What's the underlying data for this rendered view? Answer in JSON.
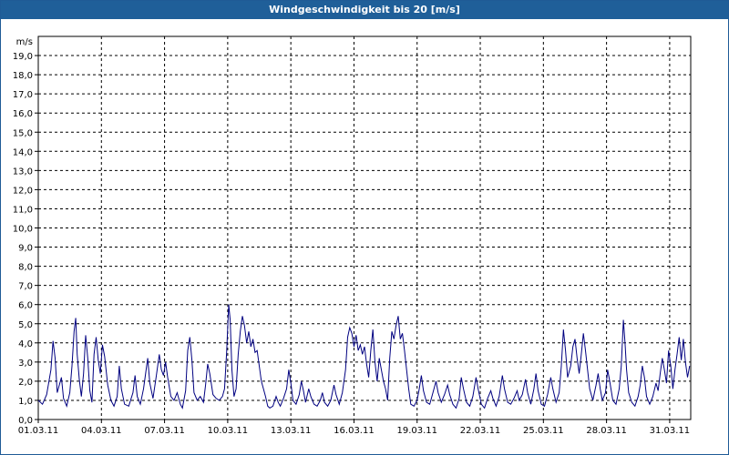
{
  "window": {
    "title": "Windgeschwindigkeit bis 20 [m/s]"
  },
  "chart_data": {
    "type": "line",
    "title": "Windgeschwindigkeit bis 20 [m/s]",
    "ylabel": "m/s",
    "ylim": [
      0,
      20
    ],
    "xlim": [
      0,
      31
    ],
    "y_ticks": [
      "0,0",
      "1,0",
      "2,0",
      "3,0",
      "4,0",
      "5,0",
      "6,0",
      "7,0",
      "8,0",
      "9,0",
      "10,0",
      "11,0",
      "12,0",
      "13,0",
      "14,0",
      "15,0",
      "16,0",
      "17,0",
      "18,0",
      "19,0"
    ],
    "x_ticks": [
      {
        "day": 0,
        "label": "01.03.11"
      },
      {
        "day": 3,
        "label": "04.03.11"
      },
      {
        "day": 6,
        "label": "07.03.11"
      },
      {
        "day": 9,
        "label": "10.03.11"
      },
      {
        "day": 12,
        "label": "13.03.11"
      },
      {
        "day": 15,
        "label": "16.03.11"
      },
      {
        "day": 18,
        "label": "19.03.11"
      },
      {
        "day": 21,
        "label": "22.03.11"
      },
      {
        "day": 24,
        "label": "25.03.11"
      },
      {
        "day": 27,
        "label": "28.03.11"
      },
      {
        "day": 30,
        "label": "31.03.11"
      }
    ],
    "grid": true,
    "line_color": "#000080",
    "series": [
      {
        "values": [
          [
            0.0,
            1.0
          ],
          [
            0.2,
            0.8
          ],
          [
            0.4,
            1.3
          ],
          [
            0.6,
            2.6
          ],
          [
            0.7,
            4.1
          ],
          [
            0.8,
            3.2
          ],
          [
            0.9,
            1.4
          ],
          [
            1.0,
            1.8
          ],
          [
            1.1,
            2.2
          ],
          [
            1.2,
            1.1
          ],
          [
            1.35,
            0.7
          ],
          [
            1.5,
            1.4
          ],
          [
            1.6,
            2.8
          ],
          [
            1.7,
            4.6
          ],
          [
            1.78,
            5.3
          ],
          [
            1.85,
            3.4
          ],
          [
            1.95,
            2.1
          ],
          [
            2.05,
            1.2
          ],
          [
            2.15,
            2.4
          ],
          [
            2.25,
            4.4
          ],
          [
            2.35,
            3.2
          ],
          [
            2.45,
            1.5
          ],
          [
            2.55,
            0.9
          ],
          [
            2.65,
            3.4
          ],
          [
            2.75,
            4.3
          ],
          [
            2.85,
            3.1
          ],
          [
            2.95,
            2.4
          ],
          [
            3.05,
            3.9
          ],
          [
            3.15,
            3.3
          ],
          [
            3.3,
            1.8
          ],
          [
            3.45,
            1.0
          ],
          [
            3.6,
            0.7
          ],
          [
            3.75,
            1.2
          ],
          [
            3.85,
            2.8
          ],
          [
            3.95,
            1.6
          ],
          [
            4.1,
            0.8
          ],
          [
            4.3,
            0.7
          ],
          [
            4.5,
            1.4
          ],
          [
            4.6,
            2.3
          ],
          [
            4.7,
            1.2
          ],
          [
            4.85,
            0.8
          ],
          [
            5.0,
            1.6
          ],
          [
            5.1,
            2.4
          ],
          [
            5.2,
            3.2
          ],
          [
            5.3,
            1.9
          ],
          [
            5.45,
            1.1
          ],
          [
            5.6,
            2.2
          ],
          [
            5.75,
            3.4
          ],
          [
            5.85,
            2.6
          ],
          [
            5.95,
            2.3
          ],
          [
            6.05,
            3.0
          ],
          [
            6.15,
            2.2
          ],
          [
            6.3,
            1.2
          ],
          [
            6.45,
            1.0
          ],
          [
            6.6,
            1.4
          ],
          [
            6.75,
            0.8
          ],
          [
            6.85,
            0.6
          ],
          [
            7.0,
            1.5
          ],
          [
            7.1,
            3.6
          ],
          [
            7.2,
            4.3
          ],
          [
            7.3,
            3.1
          ],
          [
            7.4,
            1.4
          ],
          [
            7.55,
            1.0
          ],
          [
            7.7,
            1.2
          ],
          [
            7.85,
            0.9
          ],
          [
            7.95,
            1.8
          ],
          [
            8.05,
            2.9
          ],
          [
            8.15,
            2.4
          ],
          [
            8.3,
            1.3
          ],
          [
            8.45,
            1.1
          ],
          [
            8.6,
            1.0
          ],
          [
            8.75,
            1.2
          ],
          [
            8.85,
            1.6
          ],
          [
            8.95,
            3.5
          ],
          [
            9.05,
            6.0
          ],
          [
            9.12,
            5.2
          ],
          [
            9.2,
            2.6
          ],
          [
            9.3,
            1.2
          ],
          [
            9.4,
            1.6
          ],
          [
            9.5,
            3.4
          ],
          [
            9.6,
            4.6
          ],
          [
            9.7,
            5.4
          ],
          [
            9.8,
            4.9
          ],
          [
            9.9,
            4.0
          ],
          [
            10.0,
            4.6
          ],
          [
            10.1,
            3.8
          ],
          [
            10.2,
            4.2
          ],
          [
            10.3,
            3.5
          ],
          [
            10.4,
            3.6
          ],
          [
            10.5,
            2.8
          ],
          [
            10.6,
            2.0
          ],
          [
            10.7,
            1.6
          ],
          [
            10.8,
            1.2
          ],
          [
            10.9,
            0.7
          ],
          [
            11.0,
            0.6
          ],
          [
            11.15,
            0.7
          ],
          [
            11.3,
            1.2
          ],
          [
            11.4,
            0.9
          ],
          [
            11.5,
            0.7
          ],
          [
            11.65,
            1.1
          ],
          [
            11.8,
            1.6
          ],
          [
            11.9,
            2.6
          ],
          [
            12.0,
            1.9
          ],
          [
            12.1,
            1.0
          ],
          [
            12.25,
            0.8
          ],
          [
            12.4,
            1.3
          ],
          [
            12.5,
            2.0
          ],
          [
            12.6,
            1.5
          ],
          [
            12.7,
            0.9
          ],
          [
            12.85,
            1.6
          ],
          [
            12.95,
            1.2
          ],
          [
            13.1,
            0.8
          ],
          [
            13.25,
            0.7
          ],
          [
            13.4,
            1.0
          ],
          [
            13.5,
            1.4
          ],
          [
            13.6,
            0.9
          ],
          [
            13.75,
            0.7
          ],
          [
            13.9,
            1.0
          ],
          [
            14.05,
            1.8
          ],
          [
            14.15,
            1.3
          ],
          [
            14.3,
            0.8
          ],
          [
            14.45,
            1.4
          ],
          [
            14.6,
            2.6
          ],
          [
            14.7,
            4.3
          ],
          [
            14.8,
            4.8
          ],
          [
            14.9,
            4.5
          ],
          [
            15.0,
            3.8
          ],
          [
            15.1,
            4.4
          ],
          [
            15.2,
            3.6
          ],
          [
            15.3,
            3.9
          ],
          [
            15.4,
            3.4
          ],
          [
            15.5,
            3.8
          ],
          [
            15.6,
            2.9
          ],
          [
            15.7,
            2.2
          ],
          [
            15.8,
            3.6
          ],
          [
            15.9,
            4.7
          ],
          [
            16.0,
            3.0
          ],
          [
            16.1,
            2.0
          ],
          [
            16.2,
            3.2
          ],
          [
            16.3,
            2.6
          ],
          [
            16.4,
            2.0
          ],
          [
            16.5,
            1.6
          ],
          [
            16.6,
            1.0
          ],
          [
            16.7,
            3.2
          ],
          [
            16.8,
            4.6
          ],
          [
            16.9,
            4.2
          ],
          [
            17.0,
            4.9
          ],
          [
            17.1,
            5.4
          ],
          [
            17.2,
            4.2
          ],
          [
            17.3,
            4.5
          ],
          [
            17.4,
            3.6
          ],
          [
            17.5,
            2.6
          ],
          [
            17.6,
            1.6
          ],
          [
            17.7,
            0.8
          ],
          [
            17.85,
            0.7
          ],
          [
            18.0,
            1.0
          ],
          [
            18.1,
            1.6
          ],
          [
            18.2,
            2.3
          ],
          [
            18.3,
            1.5
          ],
          [
            18.45,
            0.9
          ],
          [
            18.6,
            0.8
          ],
          [
            18.75,
            1.4
          ],
          [
            18.9,
            2.0
          ],
          [
            19.0,
            1.4
          ],
          [
            19.15,
            0.9
          ],
          [
            19.3,
            1.3
          ],
          [
            19.45,
            1.8
          ],
          [
            19.55,
            1.3
          ],
          [
            19.7,
            0.8
          ],
          [
            19.85,
            0.6
          ],
          [
            20.0,
            1.1
          ],
          [
            20.1,
            2.2
          ],
          [
            20.2,
            1.6
          ],
          [
            20.35,
            0.9
          ],
          [
            20.5,
            0.7
          ],
          [
            20.65,
            1.2
          ],
          [
            20.8,
            2.2
          ],
          [
            20.9,
            1.6
          ],
          [
            21.05,
            0.8
          ],
          [
            21.2,
            0.6
          ],
          [
            21.35,
            1.1
          ],
          [
            21.5,
            1.5
          ],
          [
            21.6,
            1.1
          ],
          [
            21.75,
            0.7
          ],
          [
            21.9,
            1.2
          ],
          [
            22.05,
            2.3
          ],
          [
            22.15,
            1.6
          ],
          [
            22.3,
            0.9
          ],
          [
            22.45,
            0.8
          ],
          [
            22.6,
            1.1
          ],
          [
            22.75,
            1.5
          ],
          [
            22.85,
            1.0
          ],
          [
            23.0,
            1.3
          ],
          [
            23.15,
            2.1
          ],
          [
            23.25,
            1.4
          ],
          [
            23.4,
            0.8
          ],
          [
            23.55,
            1.6
          ],
          [
            23.65,
            2.4
          ],
          [
            23.75,
            1.5
          ],
          [
            23.9,
            0.8
          ],
          [
            24.05,
            0.7
          ],
          [
            24.2,
            1.3
          ],
          [
            24.35,
            2.2
          ],
          [
            24.45,
            1.6
          ],
          [
            24.6,
            0.9
          ],
          [
            24.75,
            1.4
          ],
          [
            24.85,
            2.8
          ],
          [
            24.95,
            4.7
          ],
          [
            25.05,
            3.6
          ],
          [
            25.15,
            2.2
          ],
          [
            25.3,
            2.8
          ],
          [
            25.4,
            3.8
          ],
          [
            25.5,
            4.2
          ],
          [
            25.6,
            3.2
          ],
          [
            25.7,
            2.4
          ],
          [
            25.8,
            3.4
          ],
          [
            25.9,
            4.5
          ],
          [
            26.0,
            3.6
          ],
          [
            26.1,
            2.6
          ],
          [
            26.2,
            1.6
          ],
          [
            26.35,
            1.0
          ],
          [
            26.5,
            1.8
          ],
          [
            26.6,
            2.4
          ],
          [
            26.7,
            1.6
          ],
          [
            26.8,
            1.0
          ],
          [
            26.95,
            1.4
          ],
          [
            27.05,
            2.6
          ],
          [
            27.15,
            2.0
          ],
          [
            27.3,
            1.0
          ],
          [
            27.45,
            0.8
          ],
          [
            27.6,
            1.6
          ],
          [
            27.7,
            2.8
          ],
          [
            27.8,
            5.2
          ],
          [
            27.88,
            4.0
          ],
          [
            27.95,
            2.6
          ],
          [
            28.05,
            1.4
          ],
          [
            28.2,
            0.9
          ],
          [
            28.35,
            0.7
          ],
          [
            28.5,
            1.2
          ],
          [
            28.6,
            1.8
          ],
          [
            28.7,
            2.8
          ],
          [
            28.8,
            2.2
          ],
          [
            28.9,
            1.2
          ],
          [
            29.05,
            0.8
          ],
          [
            29.2,
            1.2
          ],
          [
            29.35,
            1.9
          ],
          [
            29.45,
            1.5
          ],
          [
            29.55,
            2.4
          ],
          [
            29.65,
            3.2
          ],
          [
            29.75,
            2.6
          ],
          [
            29.85,
            1.9
          ],
          [
            29.95,
            3.6
          ],
          [
            30.05,
            2.8
          ],
          [
            30.15,
            1.6
          ],
          [
            30.25,
            2.6
          ],
          [
            30.35,
            3.4
          ],
          [
            30.45,
            4.3
          ],
          [
            30.55,
            3.1
          ],
          [
            30.65,
            4.2
          ],
          [
            30.75,
            3.0
          ],
          [
            30.85,
            2.2
          ],
          [
            30.95,
            2.8
          ]
        ]
      }
    ]
  }
}
